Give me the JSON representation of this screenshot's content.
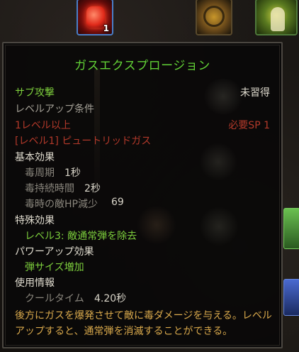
{
  "skill_bar": {
    "gas_skill_level": "1"
  },
  "tooltip": {
    "title": "ガスエクスプロージョン",
    "type": "サブ攻撃",
    "learn_status": "未習得",
    "req_header": "レベルアップ条件",
    "req_level": "1レベル以上",
    "req_sp": "必要SP 1",
    "req_skill": "[レベル1] ピュートリッドガス",
    "basic_header": "基本効果",
    "stats": [
      {
        "label": "毒周期",
        "value": "1秒"
      },
      {
        "label": "毒持続時間",
        "value": "2秒"
      },
      {
        "label": "毒時の敵HP減少",
        "value": "69"
      }
    ],
    "special_header": "特殊効果",
    "special_effect": "レベル3: 敵通常弾を除去",
    "powerup_header": "パワーアップ効果",
    "powerup_effect": "弾サイズ増加",
    "usage_header": "使用情報",
    "cooldown_label": "クールタイム",
    "cooldown_value": "4.20秒",
    "description": "後方にガスを爆発させて敵に毒ダメージを与える。レベルアップすると、通常弾を消滅することができる。"
  },
  "colors": {
    "title": "#62d236",
    "green_text": "#7ccd3c",
    "red_text": "#b3392a",
    "description": "#d9a94c"
  }
}
